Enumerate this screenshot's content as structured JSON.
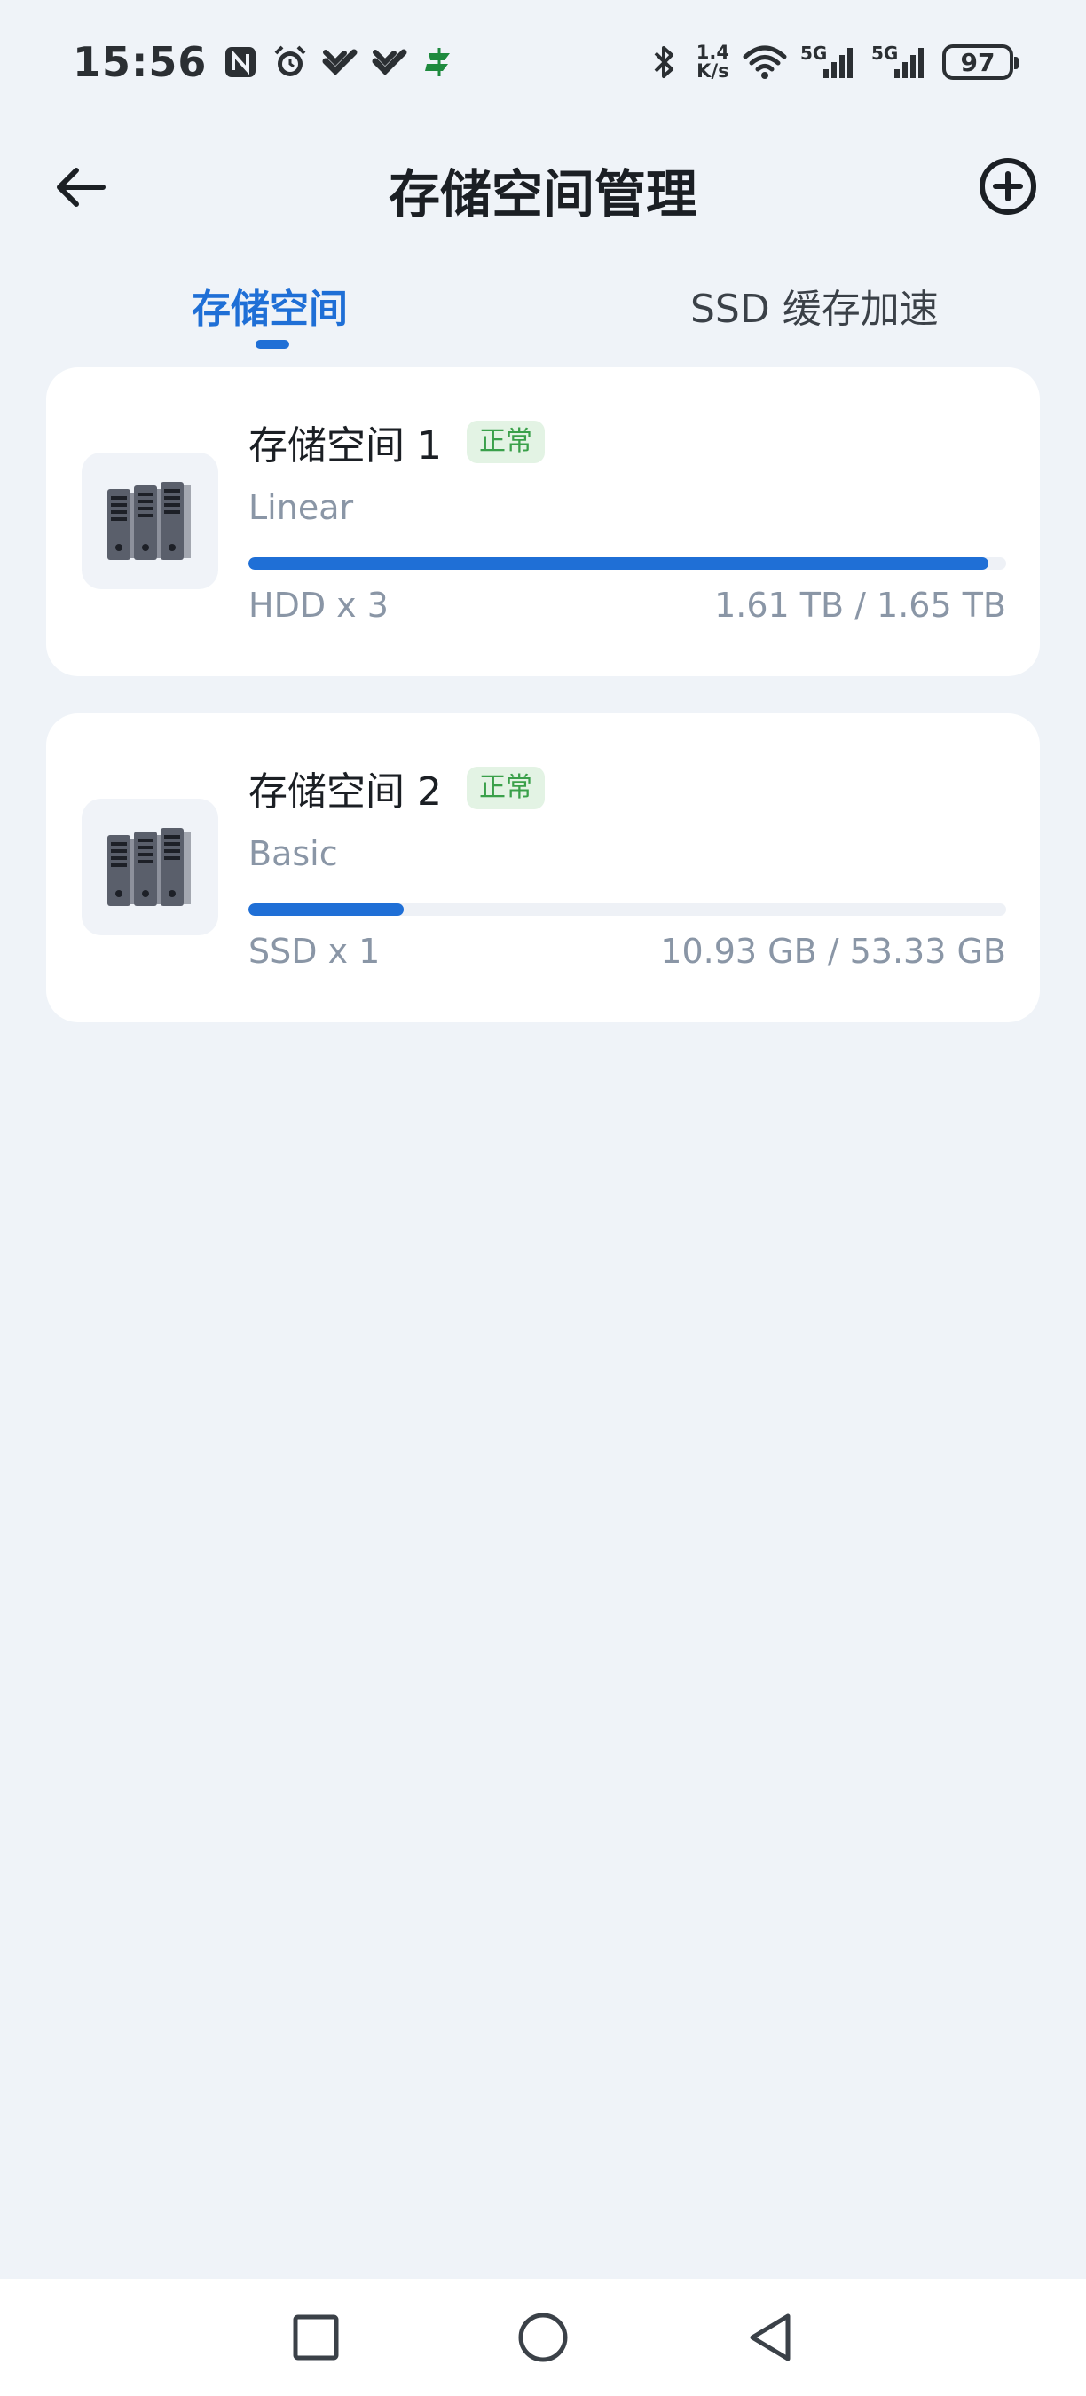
{
  "status_bar": {
    "time": "15:56",
    "left_icons": [
      "nfc-icon",
      "alarm-icon",
      "app-notification-icon",
      "app-notification-icon",
      "postal-app-icon"
    ],
    "net_speed_value": "1.4",
    "net_speed_unit": "K/s",
    "signal_1_label": "5G",
    "signal_2_label": "5G",
    "battery": "97"
  },
  "header": {
    "title": "存储空间管理"
  },
  "tabs": [
    {
      "label": "存储空间",
      "active": true
    },
    {
      "label": "SSD 缓存加速",
      "active": false
    }
  ],
  "pools": [
    {
      "name": "存储空间 1",
      "status": "正常",
      "raid_type": "Linear",
      "disks": "HDD x 3",
      "capacity": "1.61 TB / 1.65 TB",
      "usage_fraction": 0.976
    },
    {
      "name": "存储空间 2",
      "status": "正常",
      "raid_type": "Basic",
      "disks": "SSD x 1",
      "capacity": "10.93 GB / 53.33 GB",
      "usage_fraction": 0.205
    }
  ],
  "colors": {
    "accent": "#1f6fd6",
    "status_ok": "#3aa04a",
    "status_ok_bg": "#e3f3e4",
    "background": "#eff3f8"
  }
}
